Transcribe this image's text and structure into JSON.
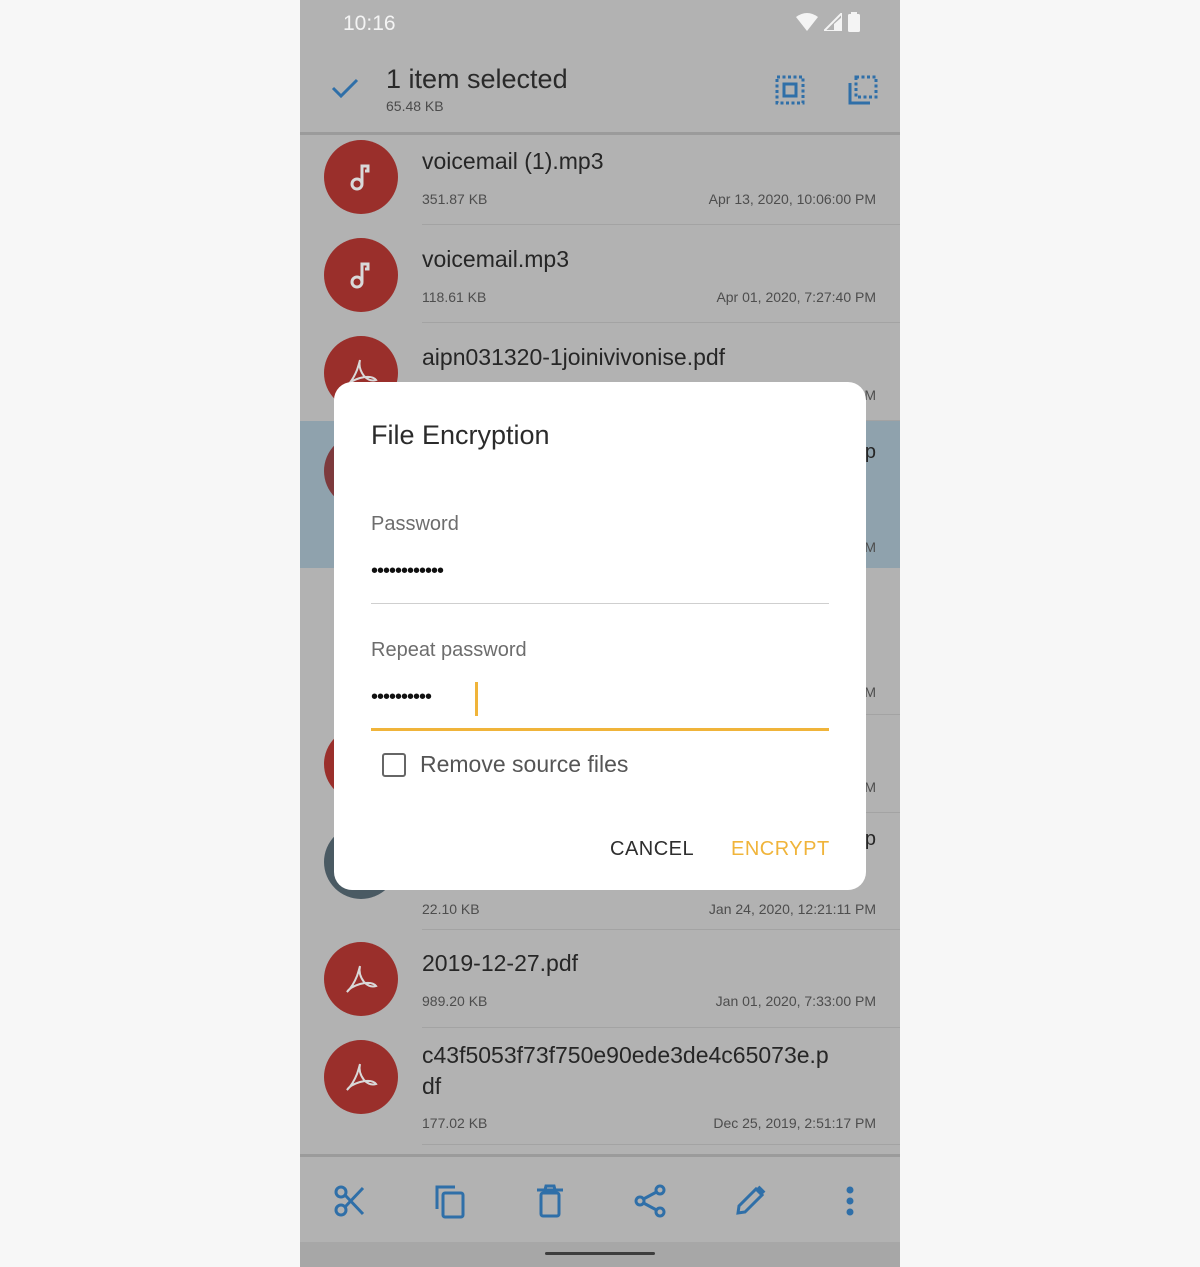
{
  "status_bar": {
    "time": "10:16",
    "icons": [
      "wifi-icon",
      "signal-icon",
      "battery-icon"
    ]
  },
  "selection_bar": {
    "title": "1 item selected",
    "size": "65.48 KB",
    "icons": [
      "check-icon",
      "select-all-icon",
      "select-inverse-icon"
    ]
  },
  "files": [
    {
      "name": "voicemail (1).mp3",
      "size": "351.87 KB",
      "date": "Apr 13, 2020, 10:06:00 PM",
      "icon": "music-note-icon",
      "color": "#9a2f2b",
      "selected": false
    },
    {
      "name": "voicemail.mp3",
      "size": "118.61 KB",
      "date": "Apr 01, 2020, 7:27:40 PM",
      "icon": "music-note-icon",
      "color": "#9a2f2b",
      "selected": false
    },
    {
      "name": "aipn031320-1joinivivonise.pdf",
      "size": "",
      "date": "M",
      "icon": "pdf-icon",
      "color": "#9a2f2b",
      "selected": false
    },
    {
      "name": "",
      "size": "",
      "date": "M",
      "icon": "file-icon",
      "color": "#9a2f2b",
      "selected": true,
      "name_tail": "p"
    },
    {
      "name": "",
      "size": "",
      "date": "M",
      "icon": "",
      "color": "",
      "selected": false
    },
    {
      "name": "",
      "size": "",
      "date": "M",
      "icon": "pdf-icon",
      "color": "#9a2f2b",
      "selected": false
    },
    {
      "name": "",
      "size": "22.10 KB",
      "date": "Jan 24, 2020, 12:21:11 PM",
      "icon": "file-icon",
      "color": "#4a5a63",
      "selected": false,
      "name_tail": "p"
    },
    {
      "name": "2019-12-27.pdf",
      "size": "989.20 KB",
      "date": "Jan 01, 2020, 7:33:00 PM",
      "icon": "pdf-icon",
      "color": "#9a2f2b",
      "selected": false
    },
    {
      "name": "c43f5053f73f750e90ede3de4c65073e.pdf",
      "name_display": "c43f5053f73f750e90ede3de4c65073e.p\ndf",
      "size": "177.02 KB",
      "date": "Dec 25, 2019, 2:51:17 PM",
      "icon": "pdf-icon",
      "color": "#9a2f2b",
      "selected": false
    }
  ],
  "dialog": {
    "title": "File Encryption",
    "password_label": "Password",
    "password_value": "••••••••••••",
    "repeat_label": "Repeat password",
    "repeat_value": "••••••••••",
    "checkbox_label": "Remove source files",
    "checkbox_checked": false,
    "cancel_label": "CANCEL",
    "encrypt_label": "ENCRYPT",
    "accent_color": "#f0b43a"
  },
  "bottom_actions": [
    {
      "name": "cut",
      "icon": "scissors-icon"
    },
    {
      "name": "copy",
      "icon": "copy-icon"
    },
    {
      "name": "delete",
      "icon": "trash-icon"
    },
    {
      "name": "share",
      "icon": "share-icon"
    },
    {
      "name": "rename",
      "icon": "pencil-icon"
    },
    {
      "name": "more",
      "icon": "more-vertical-icon"
    }
  ],
  "colors": {
    "icon_blue": "#2f6fa8",
    "scrim_bg": "#b2b2b2",
    "selected_row": "#8fa2ad"
  }
}
